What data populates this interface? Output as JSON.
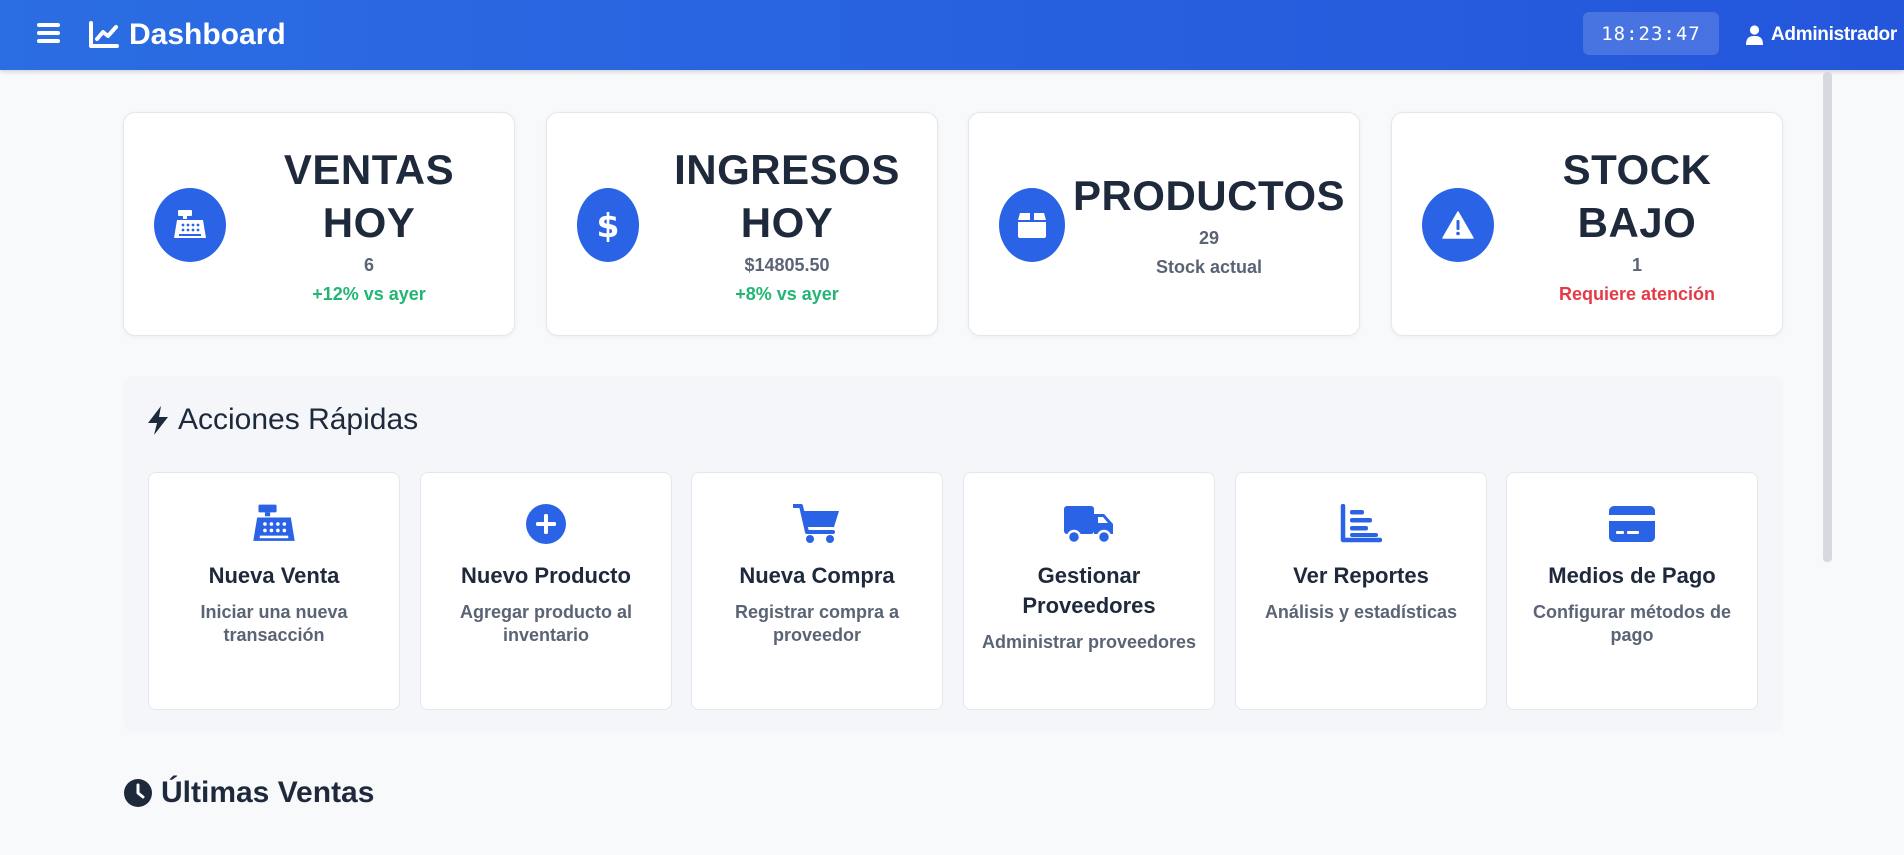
{
  "header": {
    "title": "Dashboard",
    "clock": "18:23:47",
    "user": "Administrador"
  },
  "stats": [
    {
      "label_line1": "VENTAS",
      "label_line2": "HOY",
      "value": "6",
      "note": "+12% vs ayer",
      "note_color": "#22b573",
      "icon": "cash-register-icon"
    },
    {
      "label_line1": "INGRESOS",
      "label_line2": "HOY",
      "value": "$14805.50",
      "note": "+8% vs ayer",
      "note_color": "#22b573",
      "icon": "dollar-icon"
    },
    {
      "label_line1": "PRODUCTOS",
      "label_line2": "",
      "value": "29",
      "note": "Stock actual",
      "note_color": "#5b6474",
      "icon": "box-icon"
    },
    {
      "label_line1": "STOCK",
      "label_line2": "BAJO",
      "value": "1",
      "note": "Requiere atención",
      "note_color": "#e53945",
      "icon": "warning-icon"
    }
  ],
  "quick_actions": {
    "title": "Acciones Rápidas",
    "items": [
      {
        "title": "Nueva Venta",
        "desc": "Iniciar una nueva transacción",
        "icon": "cash-register-icon"
      },
      {
        "title": "Nuevo Producto",
        "desc": "Agregar producto al inventario",
        "icon": "plus-circle-icon"
      },
      {
        "title": "Nueva Compra",
        "desc": "Registrar compra a proveedor",
        "icon": "cart-icon"
      },
      {
        "title": "Gestionar Proveedores",
        "desc": "Administrar proveedores",
        "icon": "truck-icon"
      },
      {
        "title": "Ver Reportes",
        "desc": "Análisis y estadísticas",
        "icon": "bar-chart-icon"
      },
      {
        "title": "Medios de Pago",
        "desc": "Configurar métodos de pago",
        "icon": "credit-card-icon"
      }
    ]
  },
  "recent_sales": {
    "title": "Últimas Ventas"
  },
  "colors": {
    "primary": "#2a63e5",
    "header": "#2456db",
    "success": "#22b573",
    "danger": "#e53945"
  }
}
